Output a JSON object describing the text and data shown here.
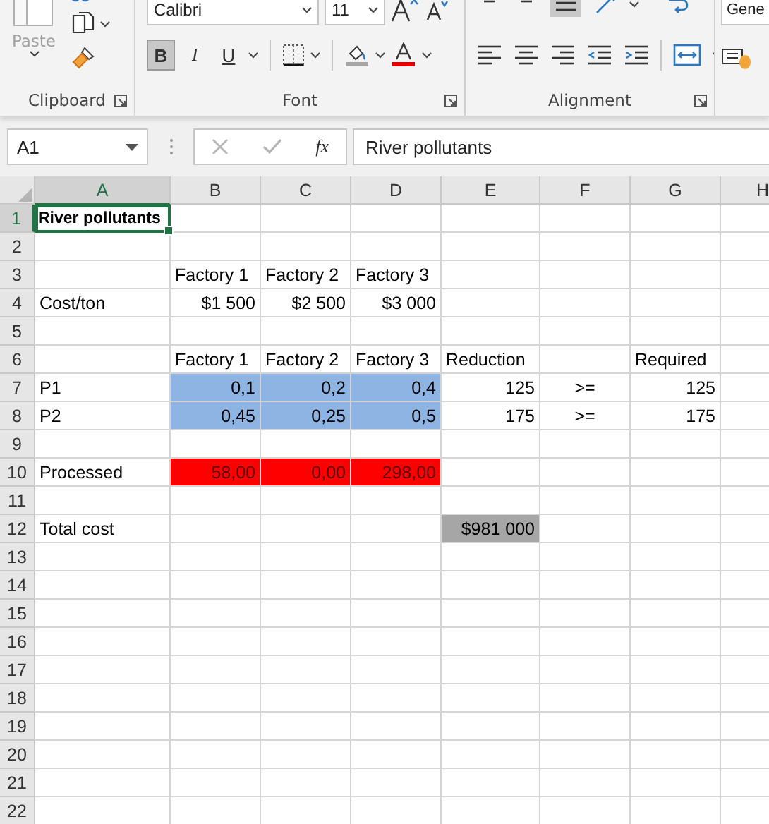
{
  "ribbon": {
    "clipboard": {
      "paste_label": "Paste",
      "paste_disabled": true
    },
    "font": {
      "font_name": "Calibri",
      "font_size": "11",
      "style_buttons": [
        {
          "label": "B",
          "kind": "bold",
          "selected": true
        },
        {
          "label": "I",
          "kind": "italic",
          "selected": false
        },
        {
          "label": "U",
          "kind": "underline",
          "selected": false
        }
      ]
    },
    "number": {
      "format": "Gene"
    },
    "groups": [
      {
        "label": "Clipboard"
      },
      {
        "label": "Font"
      },
      {
        "label": "Alignment"
      }
    ]
  },
  "formula_bar": {
    "name_box": "A1",
    "function_label": "fx",
    "formula": "River pollutants"
  },
  "sheet": {
    "columns": [
      {
        "label": "A",
        "selected": true
      },
      {
        "label": "B",
        "selected": false
      },
      {
        "label": "C",
        "selected": false
      },
      {
        "label": "D",
        "selected": false
      },
      {
        "label": "E",
        "selected": false
      },
      {
        "label": "F",
        "selected": false
      },
      {
        "label": "G",
        "selected": false
      },
      {
        "label": "H",
        "selected": false
      }
    ],
    "rows": [
      {
        "label": "1",
        "selected": true,
        "cells": {
          "A": {
            "text": "River pollutants",
            "kind": "title",
            "selected": true
          }
        }
      },
      {
        "label": "2",
        "selected": false,
        "cells": {}
      },
      {
        "label": "3",
        "selected": false,
        "cells": {
          "B": {
            "text": "Factory 1",
            "kind": "label",
            "selected": false
          },
          "C": {
            "text": "Factory 2",
            "kind": "label",
            "selected": false
          },
          "D": {
            "text": "Factory 3",
            "kind": "label",
            "selected": false
          }
        }
      },
      {
        "label": "4",
        "selected": false,
        "cells": {
          "A": {
            "text": "Cost/ton",
            "kind": "label",
            "selected": false
          },
          "B": {
            "text": "$1 500",
            "kind": "number",
            "selected": false
          },
          "C": {
            "text": "$2 500",
            "kind": "number",
            "selected": false
          },
          "D": {
            "text": "$3 000",
            "kind": "number",
            "selected": false
          }
        }
      },
      {
        "label": "5",
        "selected": false,
        "cells": {}
      },
      {
        "label": "6",
        "selected": false,
        "cells": {
          "B": {
            "text": "Factory 1",
            "kind": "label",
            "selected": false
          },
          "C": {
            "text": "Factory 2",
            "kind": "label",
            "selected": false
          },
          "D": {
            "text": "Factory 3",
            "kind": "label",
            "selected": false
          },
          "E": {
            "text": "Reduction",
            "kind": "label",
            "selected": false
          },
          "G": {
            "text": "Required",
            "kind": "label",
            "selected": false
          }
        }
      },
      {
        "label": "7",
        "selected": false,
        "cells": {
          "A": {
            "text": "P1",
            "kind": "label",
            "selected": false
          },
          "B": {
            "text": "0,1",
            "kind": "input",
            "selected": false
          },
          "C": {
            "text": "0,2",
            "kind": "input",
            "selected": false
          },
          "D": {
            "text": "0,4",
            "kind": "input",
            "selected": false
          },
          "E": {
            "text": "125",
            "kind": "number",
            "selected": false
          },
          "F": {
            "text": ">=",
            "kind": "operator",
            "selected": false
          },
          "G": {
            "text": "125",
            "kind": "number",
            "selected": false
          }
        }
      },
      {
        "label": "8",
        "selected": false,
        "cells": {
          "A": {
            "text": "P2",
            "kind": "label",
            "selected": false
          },
          "B": {
            "text": "0,45",
            "kind": "input",
            "selected": false
          },
          "C": {
            "text": "0,25",
            "kind": "input",
            "selected": false
          },
          "D": {
            "text": "0,5",
            "kind": "input",
            "selected": false
          },
          "E": {
            "text": "175",
            "kind": "number",
            "selected": false
          },
          "F": {
            "text": ">=",
            "kind": "operator",
            "selected": false
          },
          "G": {
            "text": "175",
            "kind": "number",
            "selected": false
          }
        }
      },
      {
        "label": "9",
        "selected": false,
        "cells": {}
      },
      {
        "label": "10",
        "selected": false,
        "cells": {
          "A": {
            "text": "Processed",
            "kind": "label",
            "selected": false
          },
          "B": {
            "text": "58,00",
            "kind": "result",
            "selected": false
          },
          "C": {
            "text": "0,00",
            "kind": "result",
            "selected": false
          },
          "D": {
            "text": "298,00",
            "kind": "result",
            "selected": false
          }
        }
      },
      {
        "label": "11",
        "selected": false,
        "cells": {}
      },
      {
        "label": "12",
        "selected": false,
        "cells": {
          "A": {
            "text": "Total cost",
            "kind": "label",
            "selected": false
          },
          "E": {
            "text": "$981 000",
            "kind": "total",
            "selected": false
          }
        }
      },
      {
        "label": "13",
        "selected": false,
        "cells": {}
      },
      {
        "label": "14",
        "selected": false,
        "cells": {}
      },
      {
        "label": "15",
        "selected": false,
        "cells": {}
      },
      {
        "label": "16",
        "selected": false,
        "cells": {}
      },
      {
        "label": "17",
        "selected": false,
        "cells": {}
      },
      {
        "label": "18",
        "selected": false,
        "cells": {}
      },
      {
        "label": "19",
        "selected": false,
        "cells": {}
      },
      {
        "label": "20",
        "selected": false,
        "cells": {}
      },
      {
        "label": "21",
        "selected": false,
        "cells": {}
      },
      {
        "label": "22",
        "selected": false,
        "cells": {}
      }
    ]
  }
}
